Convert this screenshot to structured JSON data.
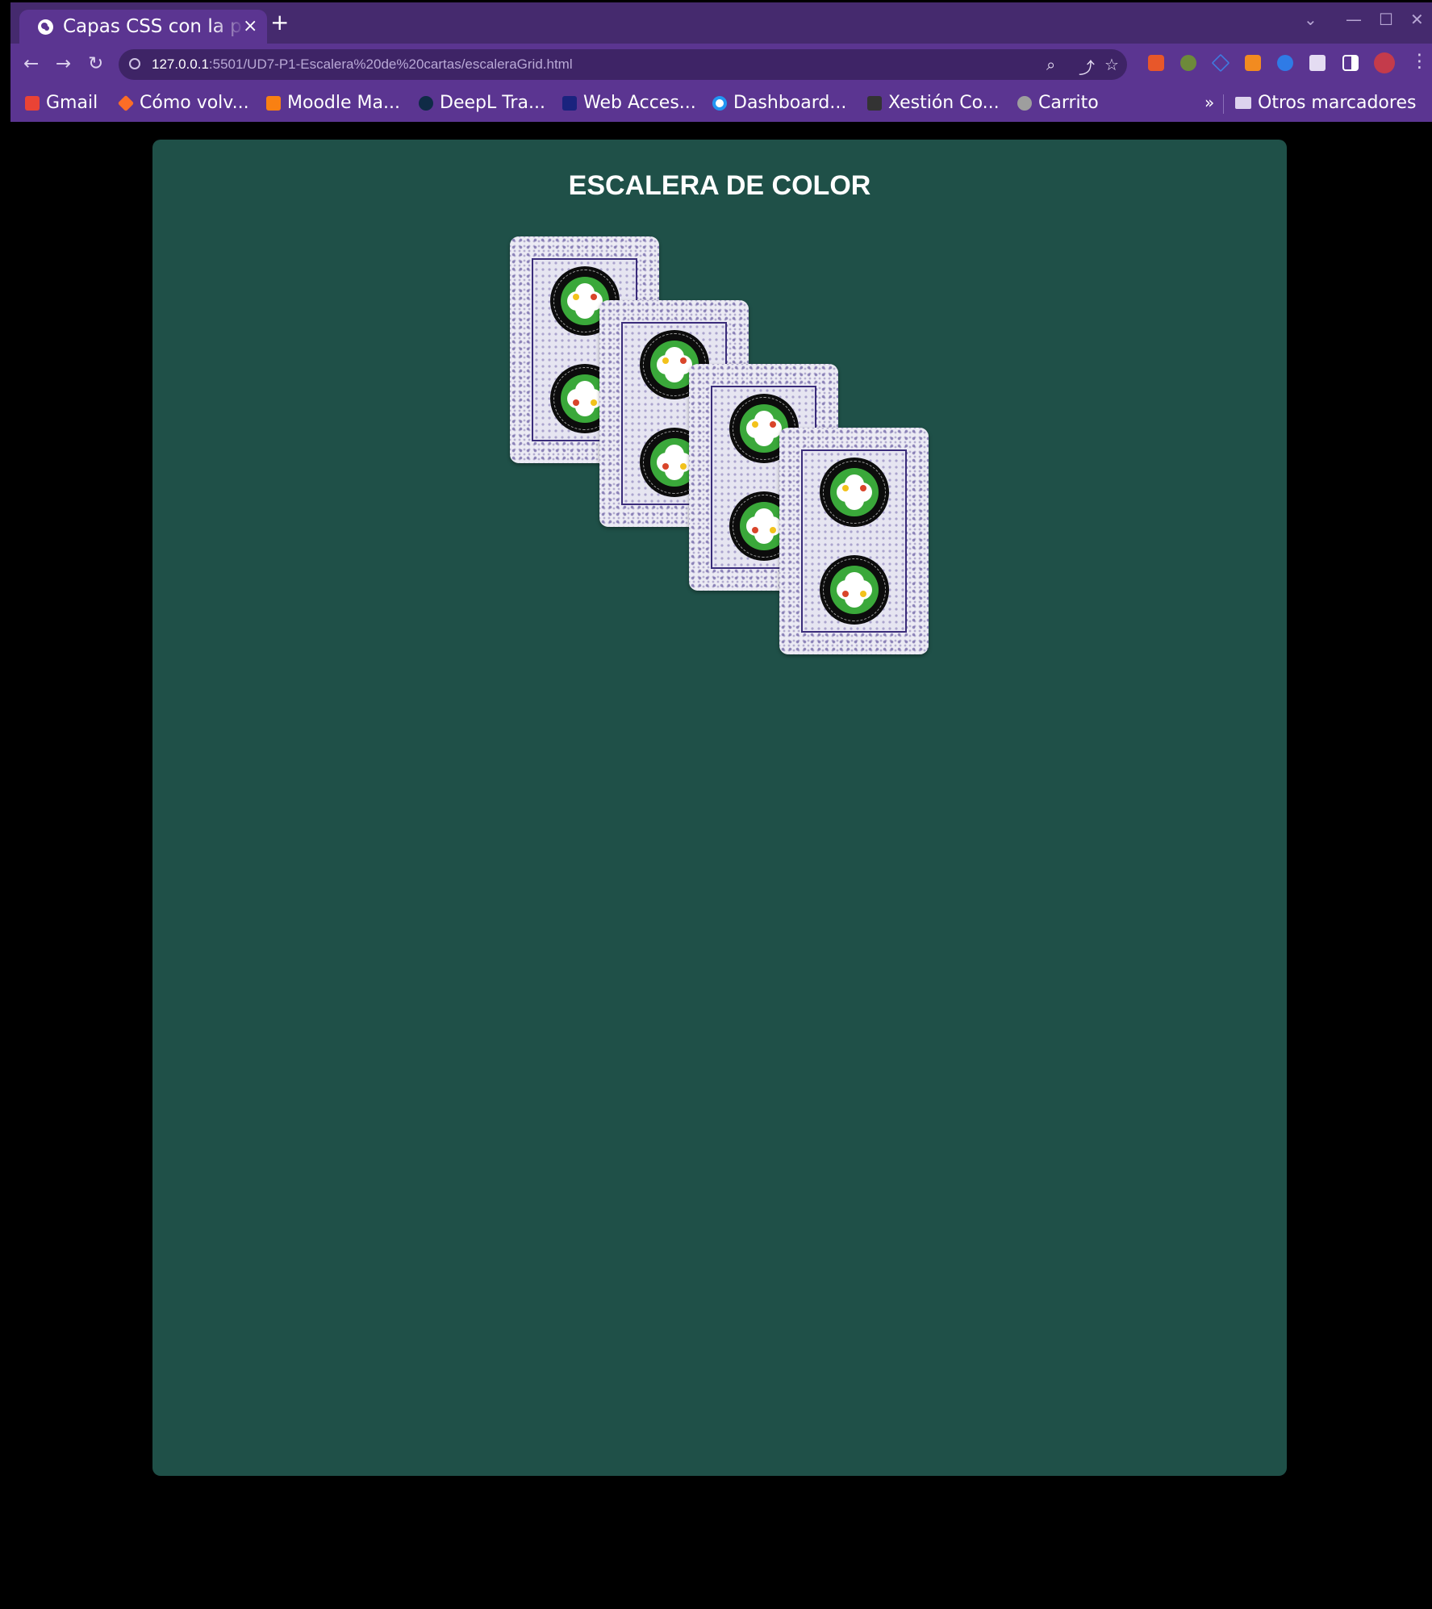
{
  "browser": {
    "tab_title": "Capas CSS con la propiedad grid",
    "tab_close": "×",
    "new_tab": "+",
    "url_host": "127.0.0.1",
    "url_rest": ":5501/UD7-P1-Escalera%20de%20cartas/escaleraGrid.html",
    "window_controls": {
      "menu": "⌄",
      "minimize": "—",
      "maximize": "☐",
      "close": "✕"
    },
    "nav": {
      "back": "←",
      "forward": "→",
      "reload": "↻"
    },
    "omnibox_icons": {
      "zoom": "⌕",
      "share": "⤴",
      "star": "☆"
    }
  },
  "bookmarks": {
    "items": [
      {
        "label": "Gmail",
        "icon": "gmail-icon",
        "color": "#ea4335"
      },
      {
        "label": "Cómo volv...",
        "icon": "gitlab-icon",
        "color": "#fc6d26"
      },
      {
        "label": "Moodle Ma...",
        "icon": "moodle-icon",
        "color": "#f98012"
      },
      {
        "label": "DeepL Tra...",
        "icon": "deepl-icon",
        "color": "#0f2b46"
      },
      {
        "label": "Web Acces...",
        "icon": "web-access-icon",
        "color": "#1a237e"
      },
      {
        "label": "Dashboard...",
        "icon": "dashboard-icon",
        "color": "#2196f3"
      },
      {
        "label": "Xestión Co...",
        "icon": "xestion-icon",
        "color": "#333333"
      },
      {
        "label": "Carrito",
        "icon": "cart-icon",
        "color": "#9e9e9e"
      }
    ],
    "overflow": "»",
    "other_folder": "Otros marcadores"
  },
  "page": {
    "heading": "ESCALERA DE COLOR",
    "table_color": "#1f5048",
    "card_count": 4
  }
}
